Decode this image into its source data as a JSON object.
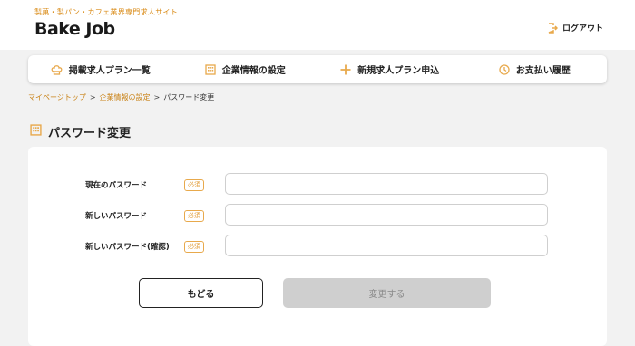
{
  "header": {
    "tagline": "製菓・製パン・カフェ業界専門求人サイト",
    "logo": "Bake Job",
    "logout_label": "ログアウト"
  },
  "nav": {
    "items": [
      {
        "label": "掲載求人プラン一覧",
        "icon": "chef-hat-icon"
      },
      {
        "label": "企業情報の設定",
        "icon": "building-icon"
      },
      {
        "label": "新規求人プラン申込",
        "icon": "plus-icon"
      },
      {
        "label": "お支払い履歴",
        "icon": "clock-icon"
      }
    ]
  },
  "breadcrumb": {
    "items": [
      "マイページトップ",
      "企業情報の設定",
      "パスワード変更"
    ],
    "separator": ">"
  },
  "page": {
    "title": "パスワード変更"
  },
  "form": {
    "required_label": "必須",
    "fields": [
      {
        "label": "現在のパスワード",
        "value": ""
      },
      {
        "label": "新しいパスワード",
        "value": ""
      },
      {
        "label": "新しいパスワード(確認)",
        "value": ""
      }
    ],
    "back_label": "もどる",
    "submit_label": "変更する"
  },
  "colors": {
    "accent": "#e8a94c",
    "link": "#c98216",
    "background": "#f2f2f2",
    "disabled_button": "#cfcfcf"
  }
}
